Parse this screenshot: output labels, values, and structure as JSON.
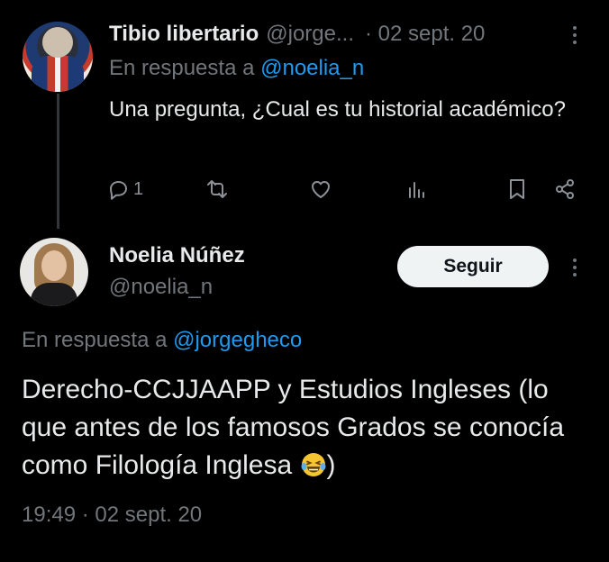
{
  "reply_tweet": {
    "author_name": "Tibio libertario",
    "author_handle": "@jorge...",
    "date": "· 02 sept. 20",
    "in_reply_prefix": "En respuesta a",
    "in_reply_mention": "@noelia_n",
    "text": "Una pregunta, ¿Cual es tu historial académico?",
    "actions": {
      "reply_count": "1"
    }
  },
  "main_tweet": {
    "author_name": "Noelia Núñez",
    "author_handle": "@noelia_n",
    "follow_label": "Seguir",
    "in_reply_prefix": "En respuesta a",
    "in_reply_mention": "@jorgegheco",
    "text": "Derecho-CCJJAAPP y Estudios Ingleses (lo que antes de los famosos Grados se conocía como Filología Inglesa",
    "text_suffix": ")",
    "emoji": "laughing-crying-emoji",
    "timestamp": "19:49 · 02 sept. 20"
  },
  "colors": {
    "background": "#000000",
    "primary_text": "#e7e9ea",
    "secondary_text": "#71767b",
    "link": "#1d9bf0",
    "follow_button_bg": "#eff3f4"
  }
}
